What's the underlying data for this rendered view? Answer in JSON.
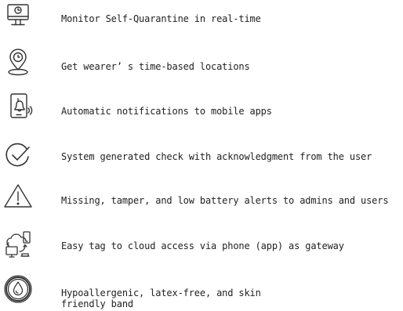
{
  "features": [
    {
      "icon": "monitor-icon",
      "text": "Monitor Self-Quarantine in real-time"
    },
    {
      "icon": "location-pin-icon",
      "text": "Get wearer’ s time-based locations"
    },
    {
      "icon": "phone-notification-icon",
      "text": "Automatic notifications to mobile apps"
    },
    {
      "icon": "check-circle-icon",
      "text": "System generated check with acknowledgment from the user"
    },
    {
      "icon": "warning-triangle-icon",
      "text": "Missing, tamper, and low battery alerts to admins and users"
    },
    {
      "icon": "cloud-devices-icon",
      "text": "Easy tag to cloud access via phone (app) as gateway"
    },
    {
      "icon": "hypoallergenic-badge-icon",
      "text": "Hypoallergenic, latex-free, and skin friendly band"
    }
  ],
  "colors": {
    "text": "#222222",
    "icon": "#333333"
  }
}
